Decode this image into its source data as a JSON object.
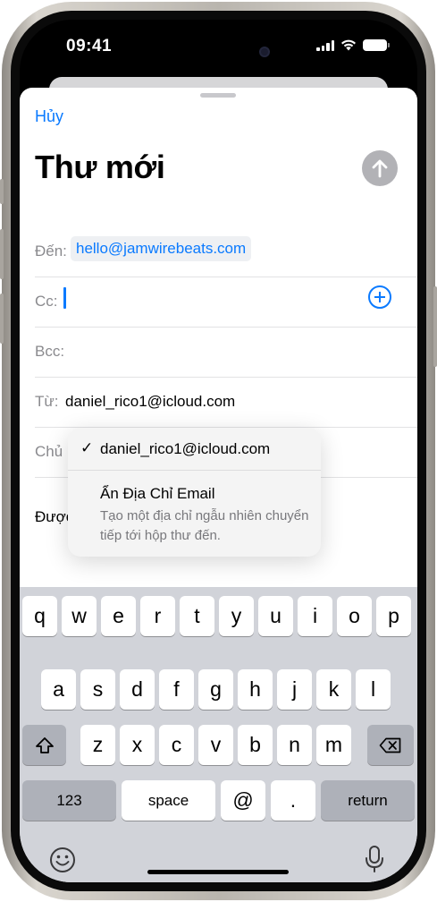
{
  "status_bar": {
    "time": "09:41"
  },
  "compose": {
    "cancel_label": "Hủy",
    "title": "Thư mới",
    "to_label": "Đến:",
    "to_value": "hello@jamwirebeats.com",
    "cc_label": "Cc:",
    "bcc_label": "Bcc:",
    "from_label": "Từ:",
    "from_value": "daniel_rico1@icloud.com",
    "subject_label_partial": "Chủ",
    "body_partial": "Được"
  },
  "from_menu": {
    "selected_account": "daniel_rico1@icloud.com",
    "hide_email_title": "Ẩn Địa Chỉ Email",
    "hide_email_desc": "Tạo một địa chỉ ngẫu nhiên chuyển tiếp tới hộp thư đến."
  },
  "keyboard": {
    "row1": [
      "q",
      "w",
      "e",
      "r",
      "t",
      "y",
      "u",
      "i",
      "o",
      "p"
    ],
    "row2": [
      "a",
      "s",
      "d",
      "f",
      "g",
      "h",
      "j",
      "k",
      "l"
    ],
    "row3": [
      "z",
      "x",
      "c",
      "v",
      "b",
      "n",
      "m"
    ],
    "num_label": "123",
    "space_label": "space",
    "at_label": "@",
    "dot_label": ".",
    "return_label": "return"
  },
  "colors": {
    "accent": "#0a7aff",
    "keyboard_bg": "#d1d3d9"
  }
}
